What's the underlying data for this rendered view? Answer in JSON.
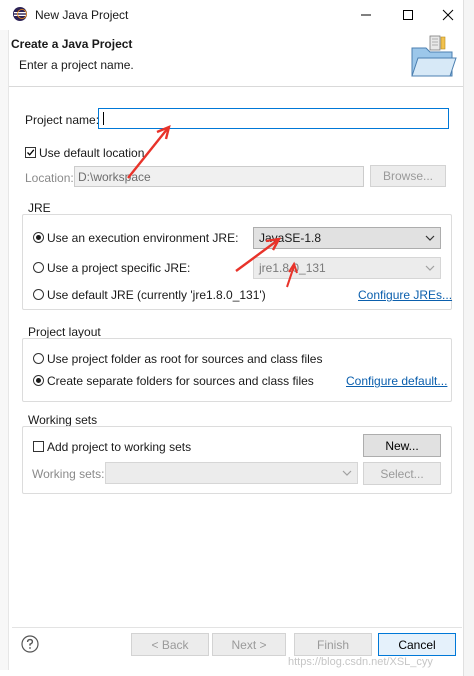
{
  "window": {
    "title": "New Java Project"
  },
  "header": {
    "title": "Create a Java Project",
    "message": "Enter a project name."
  },
  "project": {
    "name_label": "Project name:",
    "name_value": "",
    "use_default_location_label": "Use default location",
    "use_default_location_checked": true,
    "location_label": "Location:",
    "location_value": "D:\\workspace",
    "browse_label": "Browse..."
  },
  "jre": {
    "group_label": "JRE",
    "options": [
      {
        "label": "Use an execution environment JRE:",
        "selected": true
      },
      {
        "label": "Use a project specific JRE:",
        "selected": false
      },
      {
        "label": "Use default JRE (currently 'jre1.8.0_131')",
        "selected": false
      }
    ],
    "execution_env_value": "JavaSE-1.8",
    "project_specific_value": "jre1.8.0_131",
    "configure_link": "Configure JREs..."
  },
  "layout": {
    "group_label": "Project layout",
    "options": [
      {
        "label": "Use project folder as root for sources and class files",
        "selected": false
      },
      {
        "label": "Create separate folders for sources and class files",
        "selected": true
      }
    ],
    "configure_link": "Configure default..."
  },
  "working_sets": {
    "group_label": "Working sets",
    "add_label": "Add project to working sets",
    "add_checked": false,
    "new_button": "New...",
    "sets_label": "Working sets:",
    "select_button": "Select..."
  },
  "footer": {
    "help_icon": "question-mark",
    "back_button": "< Back",
    "next_button": "Next >",
    "finish_button": "Finish",
    "cancel_button": "Cancel"
  },
  "watermark": "https://blog.csdn.net/XSL_cyy",
  "colors": {
    "annotation_arrow": "#e8332a",
    "link": "#0b5fad",
    "focus_border": "#0078d7"
  }
}
